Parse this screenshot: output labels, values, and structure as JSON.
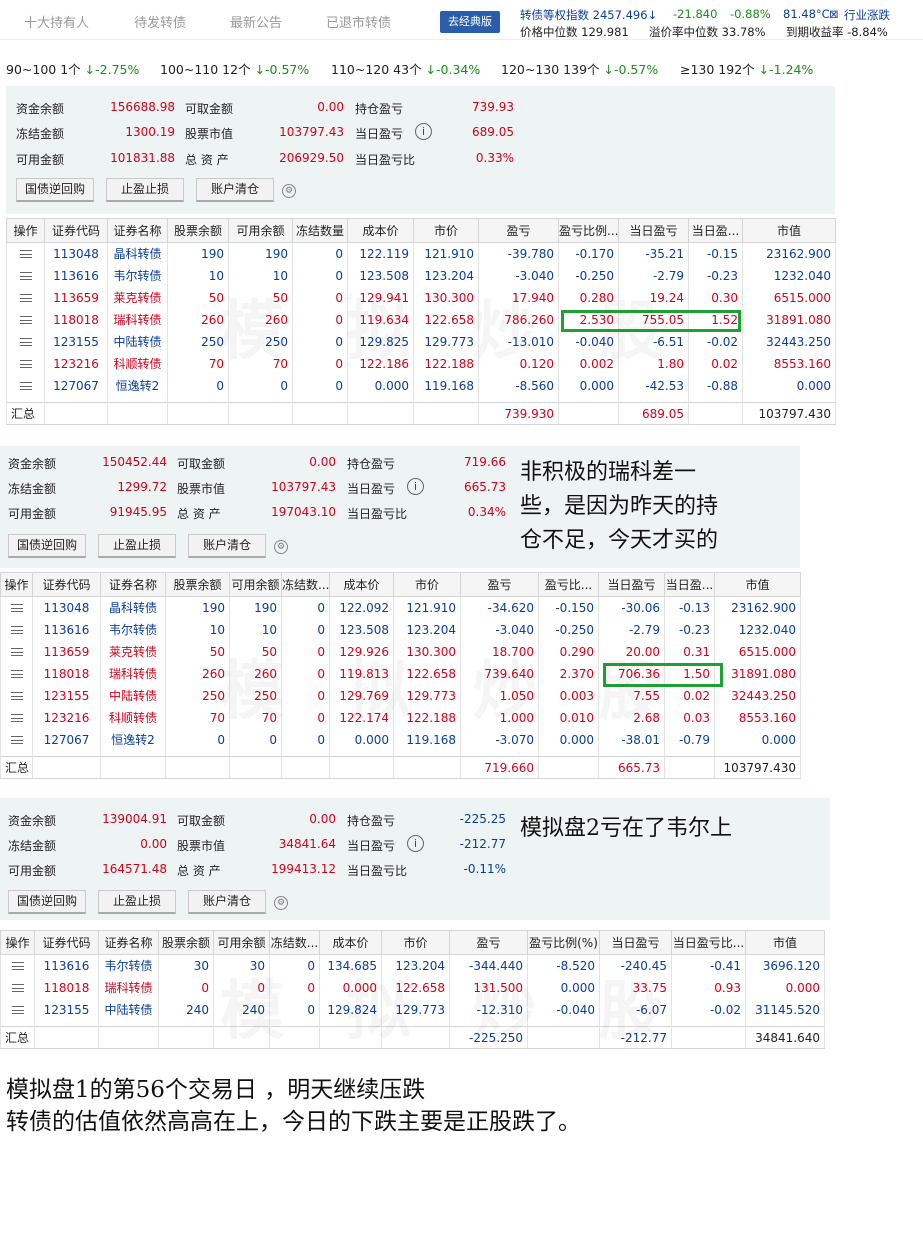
{
  "nav": {
    "tabs": [
      "十大持有人",
      "待发转债",
      "最新公告",
      "已退市转债"
    ],
    "classic_label": "去经典版"
  },
  "index": {
    "name_value": "转债等权指数 2457.496↓",
    "change": "-21.840",
    "pct": "-0.88%",
    "temp": "81.48°C",
    "industry": "行业涨跌",
    "median_price": "价格中位数 129.981",
    "median_premium": "溢价率中位数 33.78%",
    "ytm": "到期收益率 -8.84%"
  },
  "distribution": [
    {
      "range": "90~100 1个",
      "chg": "↓-2.75%"
    },
    {
      "range": "100~110 12个",
      "chg": "↓-0.57%"
    },
    {
      "range": "110~120 43个",
      "chg": "↓-0.34%"
    },
    {
      "range": "120~130 139个",
      "chg": "↓-0.57%"
    },
    {
      "range": "≥130 192个",
      "chg": "↓-1.24%"
    }
  ],
  "labels": {
    "fund_balance": "资金余额",
    "withdrawable": "可取金额",
    "position_pl": "持仓盈亏",
    "frozen": "冻结金额",
    "stock_value": "股票市值",
    "today_pl": "当日盈亏",
    "available": "可用金额",
    "total_assets": "总 资 产",
    "today_pl_ratio": "当日盈亏比",
    "btn_repo": "国债逆回购",
    "btn_stop": "止盈止损",
    "btn_clear": "账户清仓",
    "summary": "汇总"
  },
  "panel1": {
    "account": {
      "fund_balance": "156688.98",
      "withdrawable": "0.00",
      "position_pl": "739.93",
      "frozen": "1300.19",
      "stock_value": "103797.43",
      "today_pl": "689.05",
      "available": "101831.88",
      "total_assets": "206929.50",
      "today_pl_ratio": "0.33%"
    },
    "headers": [
      "操作",
      "证券代码",
      "证券名称",
      "股票余额",
      "可用余额",
      "冻结数量",
      "成本价",
      "市价",
      "盈亏",
      "盈亏比例...",
      "当日盈亏",
      "当日盈...",
      "市值"
    ],
    "rows": [
      [
        "113048",
        "晶科转债",
        "190",
        "190",
        "0",
        "122.119",
        "121.910",
        "-39.780",
        "-0.170",
        "-35.21",
        "-0.15",
        "23162.900"
      ],
      [
        "113616",
        "韦尔转债",
        "10",
        "10",
        "0",
        "123.508",
        "123.204",
        "-3.040",
        "-0.250",
        "-2.79",
        "-0.23",
        "1232.040"
      ],
      [
        "113659",
        "莱克转债",
        "50",
        "50",
        "0",
        "129.941",
        "130.300",
        "17.940",
        "0.280",
        "19.24",
        "0.30",
        "6515.000"
      ],
      [
        "118018",
        "瑞科转债",
        "260",
        "260",
        "0",
        "119.634",
        "122.658",
        "786.260",
        "2.530",
        "755.05",
        "1.52",
        "31891.080"
      ],
      [
        "123155",
        "中陆转债",
        "250",
        "250",
        "0",
        "129.825",
        "129.773",
        "-13.010",
        "-0.040",
        "-6.51",
        "-0.02",
        "32443.250"
      ],
      [
        "123216",
        "科顺转债",
        "70",
        "70",
        "0",
        "122.186",
        "122.188",
        "0.120",
        "0.002",
        "1.80",
        "0.02",
        "8553.160"
      ],
      [
        "127067",
        "恒逸转2",
        "0",
        "0",
        "0",
        "0.000",
        "119.168",
        "-8.560",
        "0.000",
        "-42.53",
        "-0.88",
        "0.000"
      ]
    ],
    "summary": {
      "pl": "739.930",
      "today_pl": "689.05",
      "value": "103797.430"
    }
  },
  "panel2": {
    "account": {
      "fund_balance": "150452.44",
      "withdrawable": "0.00",
      "position_pl": "719.66",
      "frozen": "1299.72",
      "stock_value": "103797.43",
      "today_pl": "665.73",
      "available": "91945.95",
      "total_assets": "197043.10",
      "today_pl_ratio": "0.34%"
    },
    "note": [
      "非积极的瑞科差一",
      "些，是因为昨天的持",
      "仓不足，今天才买的"
    ],
    "headers": [
      "操作",
      "证券代码",
      "证券名称",
      "股票余额",
      "可用余额",
      "冻结数...",
      "成本价",
      "市价",
      "盈亏",
      "盈亏比...",
      "当日盈亏",
      "当日盈...",
      "市值"
    ],
    "rows": [
      [
        "113048",
        "晶科转债",
        "190",
        "190",
        "0",
        "122.092",
        "121.910",
        "-34.620",
        "-0.150",
        "-30.06",
        "-0.13",
        "23162.900"
      ],
      [
        "113616",
        "韦尔转债",
        "10",
        "10",
        "0",
        "123.508",
        "123.204",
        "-3.040",
        "-0.250",
        "-2.79",
        "-0.23",
        "1232.040"
      ],
      [
        "113659",
        "莱克转债",
        "50",
        "50",
        "0",
        "129.926",
        "130.300",
        "18.700",
        "0.290",
        "20.00",
        "0.31",
        "6515.000"
      ],
      [
        "118018",
        "瑞科转债",
        "260",
        "260",
        "0",
        "119.813",
        "122.658",
        "739.640",
        "2.370",
        "706.36",
        "1.50",
        "31891.080"
      ],
      [
        "123155",
        "中陆转债",
        "250",
        "250",
        "0",
        "129.769",
        "129.773",
        "1.050",
        "0.003",
        "7.55",
        "0.02",
        "32443.250"
      ],
      [
        "123216",
        "科顺转债",
        "70",
        "70",
        "0",
        "122.174",
        "122.188",
        "1.000",
        "0.010",
        "2.68",
        "0.03",
        "8553.160"
      ],
      [
        "127067",
        "恒逸转2",
        "0",
        "0",
        "0",
        "0.000",
        "119.168",
        "-3.070",
        "0.000",
        "-38.01",
        "-0.79",
        "0.000"
      ]
    ],
    "summary": {
      "pl": "719.660",
      "today_pl": "665.73",
      "value": "103797.430"
    }
  },
  "panel3": {
    "account": {
      "fund_balance": "139004.91",
      "withdrawable": "0.00",
      "position_pl": "-225.25",
      "frozen": "0.00",
      "stock_value": "34841.64",
      "today_pl": "-212.77",
      "available": "164571.48",
      "total_assets": "199413.12",
      "today_pl_ratio": "-0.11%"
    },
    "note": "模拟盘2亏在了韦尔上",
    "headers": [
      "操作",
      "证券代码",
      "证券名称",
      "股票余额",
      "可用余额",
      "冻结数...",
      "成本价",
      "市价",
      "盈亏",
      "盈亏比例(%)",
      "当日盈亏",
      "当日盈亏比...",
      "市值"
    ],
    "rows": [
      [
        "113616",
        "韦尔转债",
        "30",
        "30",
        "0",
        "134.685",
        "123.204",
        "-344.440",
        "-8.520",
        "-240.45",
        "-0.41",
        "3696.120"
      ],
      [
        "118018",
        "瑞科转债",
        "0",
        "0",
        "0",
        "0.000",
        "122.658",
        "131.500",
        "0.000",
        "33.75",
        "0.93",
        "0.000"
      ],
      [
        "123155",
        "中陆转债",
        "240",
        "240",
        "0",
        "129.824",
        "129.773",
        "-12.310",
        "-0.040",
        "-6.07",
        "-0.02",
        "31145.520"
      ]
    ],
    "summary": {
      "pl": "-225.250",
      "today_pl": "-212.77",
      "value": "34841.640"
    }
  },
  "footer": {
    "line1": "模拟盘1的第56个交易日 ，明天继续压跌",
    "line2": "转债的估值依然高高在上，今日的下跌主要是正股跌了。"
  }
}
